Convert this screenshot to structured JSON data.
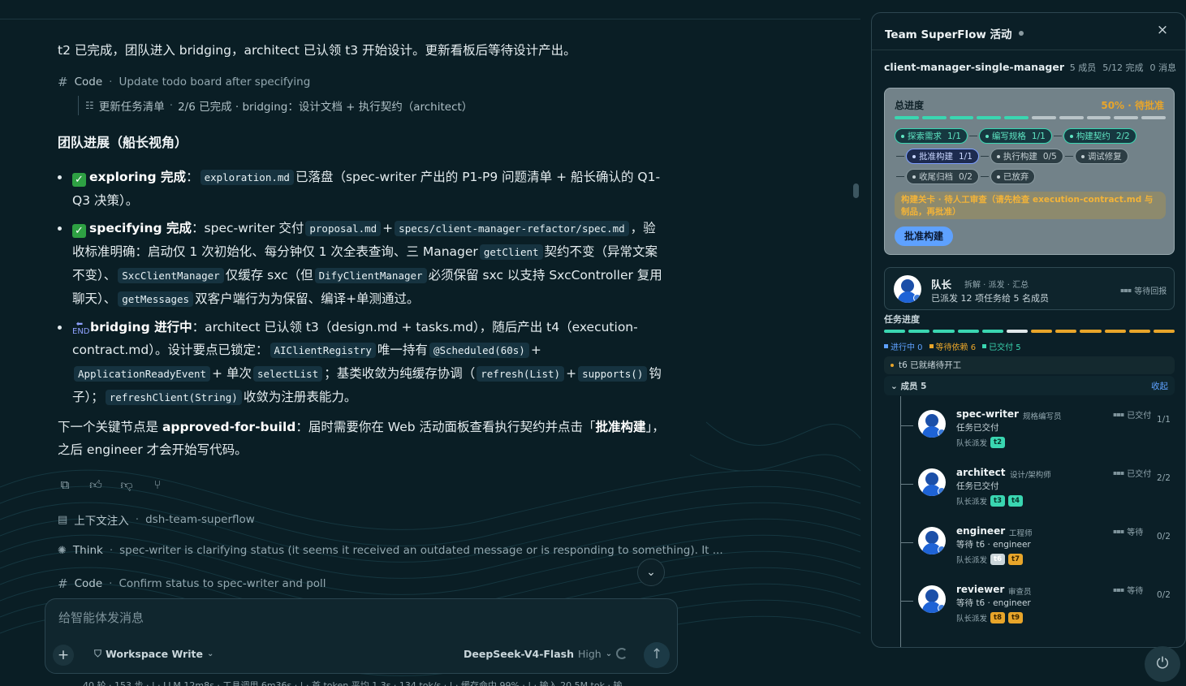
{
  "chat": {
    "intro": "t2 已完成，团队进入 bridging，architect 已认领 t3 开始设计。更新看板后等待设计产出。",
    "intro_key": "bridging",
    "tool1": {
      "label": "Code",
      "desc": "Update todo board after specifying"
    },
    "subtool": {
      "name": "更新任务清单",
      "desc": "2/6 已完成 · bridging：设计文档 + 执行契约（architect）"
    },
    "heading": "团队进展（船长视角）",
    "b1": {
      "head": "exploring 完成",
      "code1": "exploration.md",
      "t1": "已落盘（spec-writer 产出的 P1-P9 问题清单 + 船长确认的 Q1-Q3 决策）。"
    },
    "b2": {
      "head": "specifying 完成",
      "t0": "：spec-writer 交付",
      "code1": "proposal.md",
      "code2": "specs/client-manager-refactor/spec.md",
      "t1": "，验收标准明确：启动仅 1 次初始化、每分钟仅 1 次全表查询、三 Manager",
      "code3": "getClient",
      "t2": "契约不变（异常文案不变）、",
      "code4": "SxcClientManager",
      "t3": "仅缓存 sxc（但",
      "code5": "DifyClientManager",
      "t4": "必须保留 sxc 以支持 SxcController 复用聊天）、",
      "code6": "getMessages",
      "t5": "双客户端行为为保留、编译+单测通过。"
    },
    "b3": {
      "head": "bridging 进行中",
      "t0": "：architect 已认领 t3（design.md + tasks.md），随后产出 t4（execution-contract.md）。设计要点已锁定：",
      "code1": "AIClientRegistry",
      "t1": "唯一持有",
      "code2": "@Scheduled(60s)",
      "code3": "ApplicationReadyEvent",
      "t2": "+ 单次",
      "code4": "selectList",
      "t3": "；基类收敛为纯缓存协调（",
      "code5": "refresh(List)",
      "code6": "supports()",
      "t4": "钩子）；",
      "code7": "refreshClient(String)",
      "t5": "收敛为注册表能力。"
    },
    "next": {
      "t0": "下一个关键节点是",
      "k1": "approved-for-build",
      "t1": "：届时需要你在 Web 活动面板查看执行契约并点击「",
      "k2": "批准构建",
      "t2": "」，之后 engineer 才会开始写代码。"
    },
    "plus": "+",
    "ctx": {
      "label": "上下文注入",
      "desc": "dsh-team-superflow"
    },
    "think": {
      "label": "Think",
      "desc": "spec-writer is clarifying status (it seems it received an outdated message or is responding to something). It ..."
    },
    "tool2": {
      "label": "Code",
      "desc": "Confirm status to spec-writer and poll"
    }
  },
  "composer": {
    "placeholder": "给智能体发消息",
    "workspace": "Workspace Write",
    "model": "DeepSeek-V4-Flash",
    "level": "High"
  },
  "statusbar": "40 轮 · 153 步 · | · LLM 12m8s · 工具调用 6m36s · | · 首 token 平均 1.3s · 134 tok/s · | · 缓存命中 99% · | · 输入 20.5M tok · 输",
  "panel": {
    "title": "Team SuperFlow 活动",
    "team": "client-manager-single-manager",
    "meta": [
      "5 成员",
      "5/12 完成",
      "0 消息"
    ],
    "progress": {
      "title": "总进度",
      "status": "50% · 待批准",
      "fraction": 0.5,
      "stages": [
        [
          {
            "label": "探索需求",
            "count": "1/1",
            "state": "done"
          },
          {
            "label": "编写规格",
            "count": "1/1",
            "state": "done"
          },
          {
            "label": "构建契约",
            "count": "2/2",
            "state": "done"
          }
        ],
        [
          {
            "label": "批准构建",
            "count": "1/1",
            "state": "active"
          },
          {
            "label": "执行构建",
            "count": "0/5",
            "state": "idle"
          },
          {
            "label": "调试修复",
            "count": "",
            "state": "idle"
          }
        ],
        [
          {
            "label": "收尾归档",
            "count": "0/2",
            "state": "idle"
          },
          {
            "label": "已放弃",
            "count": "",
            "state": "idle"
          }
        ]
      ],
      "gate": "构建关卡 · 待人工审查（请先检查 execution-contract.md 与制品，再批准）",
      "approve": "批准构建"
    },
    "leader": {
      "name": "队长",
      "role": "拆解 · 派发 · 汇总",
      "sub": "已派发 12 项任务给 5 名成员",
      "state": "等待回报"
    },
    "task_progress": {
      "title": "任务进度",
      "segments": [
        "done",
        "done",
        "done",
        "done",
        "done",
        "white",
        "wait",
        "wait",
        "wait",
        "wait",
        "wait",
        "wait"
      ],
      "legend": [
        {
          "label": "进行中 0",
          "color": "#5ea1ff"
        },
        {
          "label": "等待依赖 6",
          "color": "#e8a52a"
        },
        {
          "label": "已交付 5",
          "color": "#3ad6b1"
        }
      ]
    },
    "ready_note": "t6 已就绪待开工",
    "members_head": "成员 5",
    "collapse": "收起",
    "members": [
      {
        "name": "spec-writer",
        "role": "规格编写员",
        "task": "任务已交付",
        "disp": "队长派发",
        "chips": [
          {
            "t": "t2",
            "k": "g"
          }
        ],
        "state": "已交付",
        "count": "1/1"
      },
      {
        "name": "architect",
        "role": "设计/架构师",
        "task": "任务已交付",
        "disp": "队长派发",
        "chips": [
          {
            "t": "t3",
            "k": "g"
          },
          {
            "t": "t4",
            "k": "g"
          }
        ],
        "state": "已交付",
        "count": "2/2"
      },
      {
        "name": "engineer",
        "role": "工程师",
        "task": "等待 t6 · engineer",
        "disp": "队长派发",
        "chips": [
          {
            "t": "t6",
            "k": "w"
          },
          {
            "t": "t7",
            "k": "o"
          }
        ],
        "state": "等待",
        "count": "0/2"
      },
      {
        "name": "reviewer",
        "role": "审查员",
        "task": "等待 t6 · engineer",
        "disp": "队长派发",
        "chips": [
          {
            "t": "t8",
            "k": "o"
          },
          {
            "t": "t9",
            "k": "o"
          }
        ],
        "state": "等待",
        "count": "0/2"
      }
    ]
  },
  "icons": {
    "close": "×",
    "power": "⏻",
    "send": "↑",
    "down": "⌄",
    "copy": "copy-icon",
    "like": "thumbs-up-icon",
    "dislike": "thumbs-down-icon",
    "branch": "branch-icon"
  }
}
